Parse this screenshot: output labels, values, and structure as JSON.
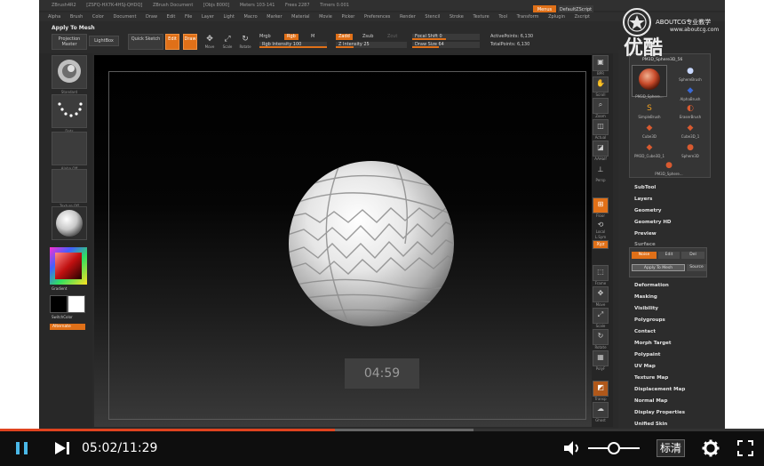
{
  "zbrush": {
    "title_segments": [
      "ZBrush4R2",
      "[ZSFQ-HX7K-4HSJ-QHDQ]",
      "ZBrush Document",
      "[Objs 8000]",
      "Meters 103-141",
      "Frees 2287",
      "Timers 0.001"
    ],
    "menu_items": [
      "Alpha",
      "Brush",
      "Color",
      "Document",
      "Draw",
      "Edit",
      "File",
      "Layer",
      "Light",
      "Macro",
      "Marker",
      "Material",
      "Movie",
      "Picker",
      "Preferences",
      "Render",
      "Stencil",
      "Stroke",
      "Texture",
      "Tool",
      "Transform",
      "Zplugin",
      "Zscript"
    ],
    "menus_label": "Menus",
    "default_script": "DefaultZScript",
    "top_label": "Apply To Mesh",
    "toolbar": {
      "projection_master": "Projection Master",
      "lightbox": "LightBox",
      "quick_sketch": "Quick Sketch",
      "edit": "Edit",
      "draw": "Draw",
      "move": "Move",
      "scale": "Scale",
      "rotate": "Rotate",
      "mrgb": "Mrgb",
      "rgb": "Rgb",
      "m": "M",
      "rgb_intensity": "Rgb Intensity 100",
      "zadd": "Zadd",
      "zsub": "Zsub",
      "zcut": "Zcut",
      "z_intensity": "Z Intensity 25",
      "focal_shift": "Focal Shift 0",
      "draw_size": "Draw Size 64",
      "active_points": "ActivePoints: 6,130",
      "total_points": "TotalPoints: 6,130"
    },
    "left_shelf": {
      "standard": "Standard",
      "dots": "Dots",
      "alpha_off": "Alpha Off",
      "texture_off": "Texture Off",
      "gradient": "Gradient",
      "switch_color": "SwitchColor",
      "alternate": "Alternate"
    },
    "right_shelf": [
      "BPR",
      "Scroll",
      "Zoom",
      "Actual",
      "AAHalf",
      "Persp",
      "Floor",
      "Local",
      "L.Sym",
      "Xyz",
      "Frame",
      "Move",
      "Scale",
      "Rotate",
      "PolyF",
      "Transp",
      "Ghost",
      "Solo"
    ],
    "tool_panel": {
      "title": "PM3D_Sphere3D_56",
      "items": [
        "PM3D_Sphere...",
        "SphereBrush",
        "AlphaBrush",
        "SimpleBrush",
        "EraserBrush",
        "Cube3D",
        "Cube3D_1",
        "PM3D_Cube3D_1",
        "Sphere3D",
        "PM3D_Sphere..."
      ]
    },
    "palette_menu": {
      "above": [
        "SubTool",
        "Layers",
        "Geometry",
        "Geometry HD",
        "Preview",
        "Surface"
      ],
      "noise_btn": "Noise",
      "edit_btn": "Edit",
      "del_btn": "Del",
      "apply_to_mesh_btn": "Apply To Mesh",
      "source_btn": "Source",
      "below": [
        "Deformation",
        "Masking",
        "Visibility",
        "Polygroups",
        "Contact",
        "Morph Target",
        "Polypaint",
        "UV Map",
        "Texture Map",
        "Displacement Map",
        "Normal Map",
        "Display Properties",
        "Unified Skin"
      ]
    },
    "canvas_timer": "04:59"
  },
  "watermark": {
    "site": "ABOUTCG专业教学",
    "url": "www.aboutcg.com",
    "youku": "优酷"
  },
  "player": {
    "time": "05:02/11:29",
    "progress_fraction": 0.438,
    "buffered_fraction": 0.62,
    "volume_fraction": 0.4,
    "quality_label": "标清",
    "icons": {
      "pause": "pause-icon",
      "next": "next-icon",
      "volume": "volume-icon",
      "settings": "gear-icon",
      "fullscreen": "fullscreen-icon"
    },
    "accent_color": "#e0431f"
  }
}
